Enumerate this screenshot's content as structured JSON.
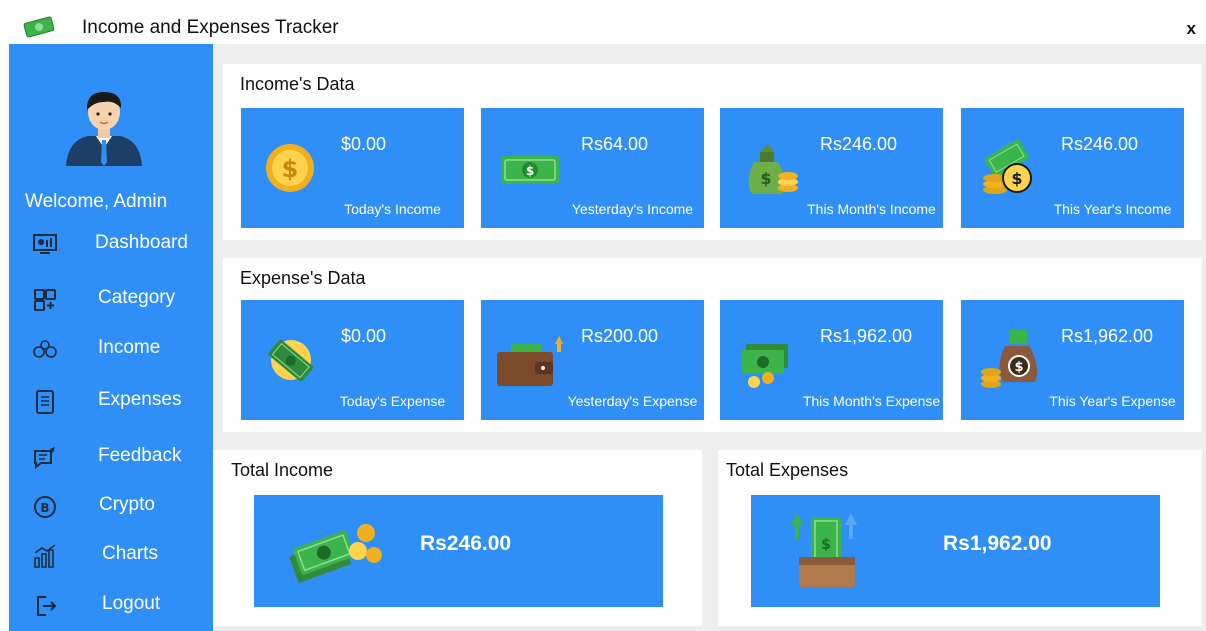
{
  "window": {
    "title": "Income and Expenses Tracker",
    "close_label": "x"
  },
  "sidebar": {
    "welcome": "Welcome, Admin",
    "items": [
      {
        "label": "Dashboard",
        "icon": "dashboard-icon"
      },
      {
        "label": "Category",
        "icon": "category-icon"
      },
      {
        "label": "Income",
        "icon": "income-icon"
      },
      {
        "label": "Expenses",
        "icon": "expenses-icon"
      },
      {
        "label": "Feedback",
        "icon": "feedback-icon"
      },
      {
        "label": "Crypto",
        "icon": "crypto-icon"
      },
      {
        "label": "Charts",
        "icon": "charts-icon"
      },
      {
        "label": "Logout",
        "icon": "logout-icon"
      }
    ]
  },
  "income": {
    "title": "Income's Data",
    "cards": [
      {
        "value": "$0.00",
        "label": "Today's Income"
      },
      {
        "value": "Rs64.00",
        "label": "Yesterday's Income"
      },
      {
        "value": "Rs246.00",
        "label": "This Month's Income"
      },
      {
        "value": "Rs246.00",
        "label": "This Year's Income"
      }
    ]
  },
  "expense": {
    "title": "Expense's Data",
    "cards": [
      {
        "value": "$0.00",
        "label": "Today's Expense"
      },
      {
        "value": "Rs200.00",
        "label": "Yesterday's Expense"
      },
      {
        "value": "Rs1,962.00",
        "label": "This Month's Expense"
      },
      {
        "value": "Rs1,962.00",
        "label": "This Year's Expense"
      }
    ]
  },
  "totals": {
    "income_title": "Total Income",
    "income_value": "Rs246.00",
    "expenses_title": "Total Expenses",
    "expenses_value": "Rs1,962.00"
  },
  "colors": {
    "accent": "#2f8ff6",
    "background": "#eeeeee",
    "panel": "#ffffff"
  }
}
